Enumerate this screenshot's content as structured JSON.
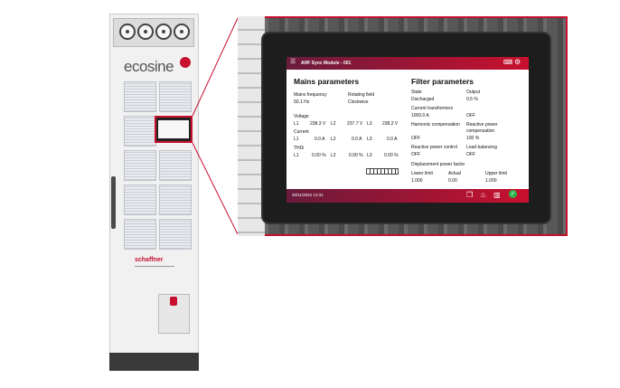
{
  "cabinet": {
    "brand": "ecosine",
    "maker": "schaffner"
  },
  "colors": {
    "accent": "#c8102e",
    "ok": "#29b34a",
    "header_start": "#6a1b3c"
  },
  "app": {
    "title": "AHF Sync Module - 001",
    "menu_icon": "menu-icon",
    "keyboard_icon": "keyboard-icon",
    "settings_icon": "gear-icon",
    "timestamp": "30/11/2022 13:31",
    "footer_icons": [
      "document-icon",
      "bell-icon",
      "bar-chart-icon",
      "check-icon"
    ]
  },
  "mains": {
    "heading": "Mains parameters",
    "freq_label": "Mains frequency",
    "freq_value": "50.1 Hz",
    "rot_label": "Rotating field",
    "rot_value": "Clockwise",
    "voltage_label": "Voltage",
    "voltage": [
      {
        "line": "L1",
        "value": "238.3 V"
      },
      {
        "line": "L2",
        "value": "237.7 V"
      },
      {
        "line": "L3",
        "value": "238.2 V"
      }
    ],
    "current_label": "Current",
    "current": [
      {
        "line": "L1",
        "value": "0.0 A"
      },
      {
        "line": "L2",
        "value": "0.0 A"
      },
      {
        "line": "L3",
        "value": "0.0 A"
      }
    ],
    "thdi_label": "THDi",
    "thdi": [
      {
        "line": "L1",
        "value": "0.00 %"
      },
      {
        "line": "L2",
        "value": "0.00 %"
      },
      {
        "line": "L3",
        "value": "0.00 %"
      }
    ]
  },
  "filter": {
    "heading": "Filter parameters",
    "state_label": "State",
    "state_value": "Discharged",
    "output_label": "Output",
    "output_value": "0.5 %",
    "ct_label": "Current transformers",
    "ct_value": "1000.0 A",
    "ct_value2": "OFF",
    "hc_label": "Harmonic compensation",
    "rpc_label": "Reactive power compensation",
    "hc_value": "OFF",
    "rpc_value": "100 %",
    "rpctrl_label": "Reactive power control",
    "lb_label": "Load balancing",
    "rpctrl_value": "OFF",
    "lb_value": "OFF",
    "dpf_label": "Displacement power factor",
    "lower_label": "Lower limit",
    "actual_label": "Actual",
    "upper_label": "Upper limit",
    "lower_value": "1.000",
    "actual_value": "0.00",
    "upper_value": "1.000"
  }
}
